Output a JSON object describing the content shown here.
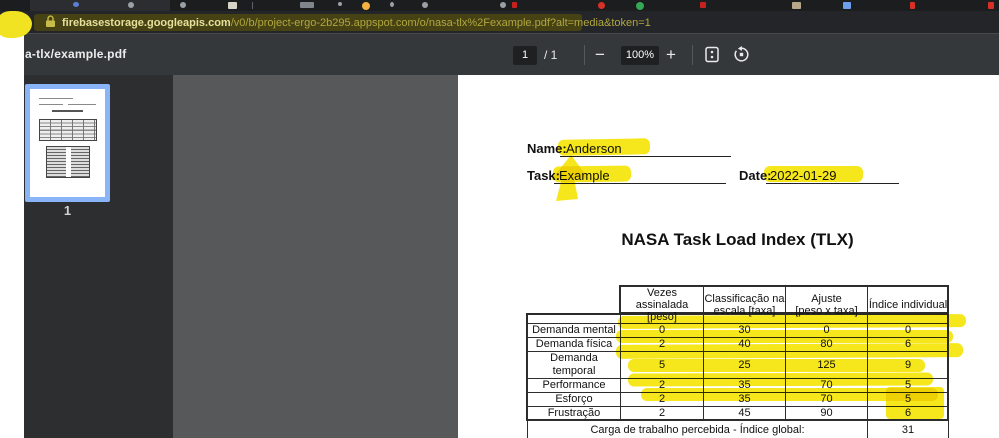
{
  "browser": {
    "url_domain": "firebasestorage.googleapis.com",
    "url_path": "/v0/b/project-ergo-2b295.appspot.com/o/nasa-tlx%2Fexample.pdf?alt=media&token=1"
  },
  "pdf_toolbar": {
    "filename": "a-tlx/example.pdf",
    "page_current": "1",
    "page_total": "/ 1",
    "minus_label": "−",
    "zoom_level": "100%",
    "plus_label": "+"
  },
  "sidebar": {
    "thumbnail_page_number": "1"
  },
  "document": {
    "name_label": "Name:",
    "name_value": "Anderson",
    "task_label": "Task:",
    "task_value": "Example",
    "date_label": "Date:",
    "date_value": "2022-01-29",
    "title": "NASA Task Load Index (TLX)"
  },
  "table": {
    "col_headers": [
      {
        "top": "",
        "bottom": ""
      },
      {
        "top": "Vezes assinalada",
        "bottom": "[peso]"
      },
      {
        "top": "Classificação na",
        "bottom": "escala [taxa]"
      },
      {
        "top": "Ajuste",
        "bottom": "[peso x taxa]"
      },
      {
        "top": "Índice individual",
        "bottom": ""
      }
    ],
    "rows": [
      {
        "label": "Demanda mental",
        "values": [
          "0",
          "30",
          "0",
          "0"
        ]
      },
      {
        "label": "Demanda física",
        "values": [
          "2",
          "40",
          "80",
          "6"
        ]
      },
      {
        "label": "Demanda temporal",
        "values": [
          "5",
          "25",
          "125",
          "9"
        ]
      },
      {
        "label": "Performance",
        "values": [
          "2",
          "35",
          "70",
          "5"
        ]
      },
      {
        "label": "Esforço",
        "values": [
          "2",
          "35",
          "70",
          "5"
        ]
      },
      {
        "label": "Frustração",
        "values": [
          "2",
          "45",
          "90",
          "6"
        ]
      }
    ],
    "footer_label": "Carga de trabalho percebida - Índice global:",
    "footer_value": "31"
  },
  "colors": {
    "marker_highlight": "#f6e71c",
    "thumbnail_selection": "#8ab4f8",
    "toolbar_bg": "#35383b",
    "url_highlight_bg": "#474214"
  }
}
